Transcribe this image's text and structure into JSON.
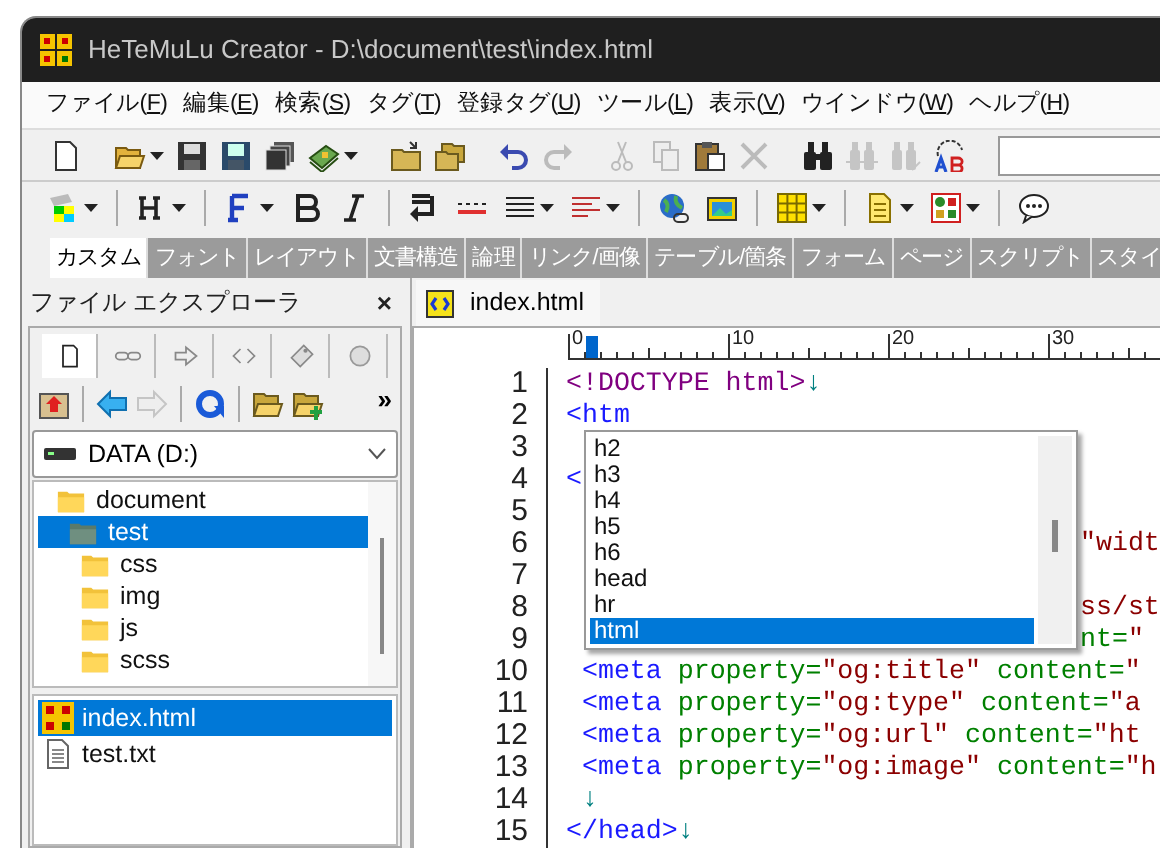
{
  "window": {
    "title": "HeTeMuLu Creator - D:\\document\\test\\index.html"
  },
  "menu": [
    {
      "before": "ファイル(",
      "key": "F",
      "after": ")"
    },
    {
      "before": "編集(",
      "key": "E",
      "after": ")"
    },
    {
      "before": "検索(",
      "key": "S",
      "after": ")"
    },
    {
      "before": "タグ(",
      "key": "T",
      "after": ")"
    },
    {
      "before": "登録タグ(",
      "key": "U",
      "after": ")"
    },
    {
      "before": "ツール(",
      "key": "L",
      "after": ")"
    },
    {
      "before": "表示(",
      "key": "V",
      "after": ")"
    },
    {
      "before": "ウインドウ(",
      "key": "W",
      "after": ")"
    },
    {
      "before": "ヘルプ(",
      "key": "H",
      "after": ")"
    }
  ],
  "toolbar_main": [
    {
      "kind": "button",
      "disabled": false,
      "dropdown": false
    },
    {
      "kind": "separator"
    },
    {
      "kind": "button",
      "disabled": false,
      "dropdown": true
    },
    {
      "kind": "button",
      "disabled": false,
      "dropdown": false
    },
    {
      "kind": "button",
      "disabled": false,
      "dropdown": false
    },
    {
      "kind": "button",
      "disabled": false,
      "dropdown": false
    },
    {
      "kind": "button",
      "disabled": false,
      "dropdown": true
    },
    {
      "kind": "separator"
    },
    {
      "kind": "button",
      "disabled": false,
      "dropdown": false
    },
    {
      "kind": "button",
      "disabled": false,
      "dropdown": false
    },
    {
      "kind": "separator"
    },
    {
      "kind": "button",
      "disabled": false,
      "dropdown": false
    },
    {
      "kind": "button",
      "disabled": true,
      "dropdown": false
    },
    {
      "kind": "separator"
    },
    {
      "kind": "button",
      "disabled": true,
      "dropdown": false
    },
    {
      "kind": "button",
      "disabled": true,
      "dropdown": false
    },
    {
      "kind": "button",
      "disabled": false,
      "dropdown": false
    },
    {
      "kind": "button",
      "disabled": true,
      "dropdown": false
    },
    {
      "kind": "separator"
    },
    {
      "kind": "button",
      "disabled": false,
      "dropdown": false
    },
    {
      "kind": "button",
      "disabled": true,
      "dropdown": false
    },
    {
      "kind": "button",
      "disabled": true,
      "dropdown": false
    },
    {
      "kind": "button",
      "disabled": false,
      "dropdown": false
    },
    {
      "kind": "field"
    }
  ],
  "toolbar_tags": [
    {
      "kind": "button",
      "dropdown": true
    },
    {
      "kind": "separator"
    },
    {
      "kind": "button",
      "dropdown": true
    },
    {
      "kind": "separator"
    },
    {
      "kind": "button",
      "dropdown": true
    },
    {
      "kind": "button",
      "dropdown": false
    },
    {
      "kind": "button",
      "dropdown": false
    },
    {
      "kind": "separator"
    },
    {
      "kind": "button",
      "dropdown": false
    },
    {
      "kind": "button",
      "dropdown": false
    },
    {
      "kind": "button",
      "dropdown": true
    },
    {
      "kind": "button",
      "dropdown": true
    },
    {
      "kind": "separator"
    },
    {
      "kind": "button",
      "dropdown": false
    },
    {
      "kind": "button",
      "dropdown": false
    },
    {
      "kind": "separator"
    },
    {
      "kind": "button",
      "dropdown": true
    },
    {
      "kind": "separator"
    },
    {
      "kind": "button",
      "dropdown": true
    },
    {
      "kind": "button",
      "dropdown": true
    },
    {
      "kind": "separator"
    },
    {
      "kind": "button",
      "dropdown": false
    }
  ],
  "tag_tabs": [
    {
      "label": "カスタム",
      "selected": true
    },
    {
      "label": "フォント",
      "selected": false
    },
    {
      "label": "レイアウト",
      "selected": false
    },
    {
      "label": "文書構造",
      "selected": false
    },
    {
      "label": "論理",
      "selected": false
    },
    {
      "label": "リンク/画像",
      "selected": false
    },
    {
      "label": "テーブル/箇条",
      "selected": false
    },
    {
      "label": "フォーム",
      "selected": false
    },
    {
      "label": "ページ",
      "selected": false
    },
    {
      "label": "スクリプト",
      "selected": false
    },
    {
      "label": "スタイ",
      "selected": false
    }
  ],
  "explorer": {
    "title": "ファイル エクスプローラ",
    "close": "×",
    "tabs": [
      {
        "selected": true
      },
      {
        "selected": false
      },
      {
        "selected": false
      },
      {
        "selected": false
      },
      {
        "selected": false
      },
      {
        "selected": false
      }
    ],
    "toolbar": [
      {
        "disabled": false
      },
      {
        "disabled": false
      },
      {
        "disabled": true
      },
      {
        "disabled": false
      },
      {
        "disabled": false
      },
      {
        "disabled": false
      }
    ],
    "more": "»",
    "drive": "DATA (D:)",
    "tree": [
      {
        "label": "document",
        "selected": false,
        "children": [
          {
            "label": "test",
            "selected": true,
            "children": [
              {
                "label": "css",
                "selected": false
              },
              {
                "label": "img",
                "selected": false
              },
              {
                "label": "js",
                "selected": false
              },
              {
                "label": "scss",
                "selected": false
              }
            ]
          }
        ]
      }
    ],
    "files": [
      {
        "name": "index.html",
        "kind": "html",
        "selected": true
      },
      {
        "name": "test.txt",
        "kind": "text",
        "selected": false
      }
    ]
  },
  "editor": {
    "tab": "index.html",
    "ruler": [
      "0",
      "10",
      "20",
      "30"
    ],
    "lines": [
      {
        "number": "1",
        "tokens": [
          {
            "kind": "doctype",
            "text": "<!DOCTYPE html>"
          },
          {
            "kind": "mark",
            "text": "↓"
          }
        ]
      },
      {
        "number": "2",
        "tokens": [
          {
            "kind": "tag",
            "text": "<htm"
          }
        ]
      },
      {
        "number": "3"
      },
      {
        "number": "4",
        "tokens": [
          {
            "kind": "tag",
            "text": "<"
          }
        ]
      },
      {
        "number": "5"
      },
      {
        "number": "6",
        "tail": [
          {
            "kind": "value",
            "text": "\"widt"
          }
        ]
      },
      {
        "number": "7"
      },
      {
        "number": "8",
        "tail": [
          {
            "kind": "value",
            "text": "ss/st"
          }
        ]
      },
      {
        "number": "9",
        "tail": [
          {
            "kind": "attr",
            "text": "nt="
          },
          {
            "kind": "value",
            "text": "\""
          }
        ]
      },
      {
        "number": "10",
        "tokens": [
          {
            "kind": "tag",
            "text": " <meta"
          },
          {
            "kind": "attr",
            "text": " property="
          },
          {
            "kind": "value",
            "text": "\"og:title\""
          },
          {
            "kind": "attr",
            "text": " content="
          },
          {
            "kind": "value",
            "text": "\""
          }
        ]
      },
      {
        "number": "11",
        "tokens": [
          {
            "kind": "tag",
            "text": " <meta"
          },
          {
            "kind": "attr",
            "text": " property="
          },
          {
            "kind": "value",
            "text": "\"og:type\""
          },
          {
            "kind": "attr",
            "text": " content="
          },
          {
            "kind": "value",
            "text": "\"a"
          }
        ]
      },
      {
        "number": "12",
        "tokens": [
          {
            "kind": "tag",
            "text": " <meta"
          },
          {
            "kind": "attr",
            "text": " property="
          },
          {
            "kind": "value",
            "text": "\"og:url\""
          },
          {
            "kind": "attr",
            "text": " content="
          },
          {
            "kind": "value",
            "text": "\"ht"
          }
        ]
      },
      {
        "number": "13",
        "tokens": [
          {
            "kind": "tag",
            "text": " <meta"
          },
          {
            "kind": "attr",
            "text": " property="
          },
          {
            "kind": "value",
            "text": "\"og:image\""
          },
          {
            "kind": "attr",
            "text": " content="
          },
          {
            "kind": "value",
            "text": "\"h"
          }
        ]
      },
      {
        "number": "14",
        "tokens": [
          {
            "kind": "mark",
            "text": " ↓"
          }
        ]
      },
      {
        "number": "15",
        "tokens": [
          {
            "kind": "tag",
            "text": "</head>"
          },
          {
            "kind": "mark",
            "text": "↓"
          }
        ]
      }
    ],
    "completion": [
      {
        "label": "h2",
        "selected": false
      },
      {
        "label": "h3",
        "selected": false
      },
      {
        "label": "h4",
        "selected": false
      },
      {
        "label": "h5",
        "selected": false
      },
      {
        "label": "h6",
        "selected": false
      },
      {
        "label": "head",
        "selected": false
      },
      {
        "label": "hr",
        "selected": false
      },
      {
        "label": "html",
        "selected": true
      }
    ]
  }
}
